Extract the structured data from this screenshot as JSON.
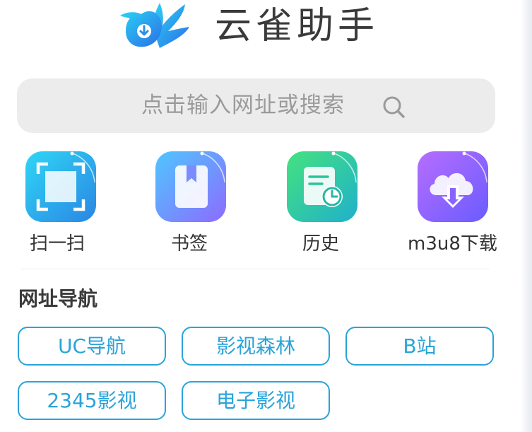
{
  "header": {
    "title": "云雀助手",
    "logo_icon": "bird-download-icon"
  },
  "search": {
    "placeholder": "点击输入网址或搜索",
    "icon": "search-icon"
  },
  "shortcuts": [
    {
      "label": "扫一扫",
      "icon": "scan-icon",
      "color_from": "#2fd1f3",
      "color_to": "#2a8fe6"
    },
    {
      "label": "书签",
      "icon": "bookmark-icon",
      "color_from": "#55c1ff",
      "color_to": "#8a6dff"
    },
    {
      "label": "历史",
      "icon": "history-icon",
      "color_from": "#43e08a",
      "color_to": "#20b4c9"
    },
    {
      "label": "m3u8下载",
      "icon": "cloud-download-icon",
      "color_from": "#b06dff",
      "color_to": "#6d5bff"
    }
  ],
  "nav_section": {
    "title": "网址导航",
    "links": [
      "UC导航",
      "影视森林",
      "B站",
      "2345影视",
      "电子影视"
    ]
  },
  "colors": {
    "accent": "#2aa3d9",
    "search_bg": "#ececec"
  }
}
